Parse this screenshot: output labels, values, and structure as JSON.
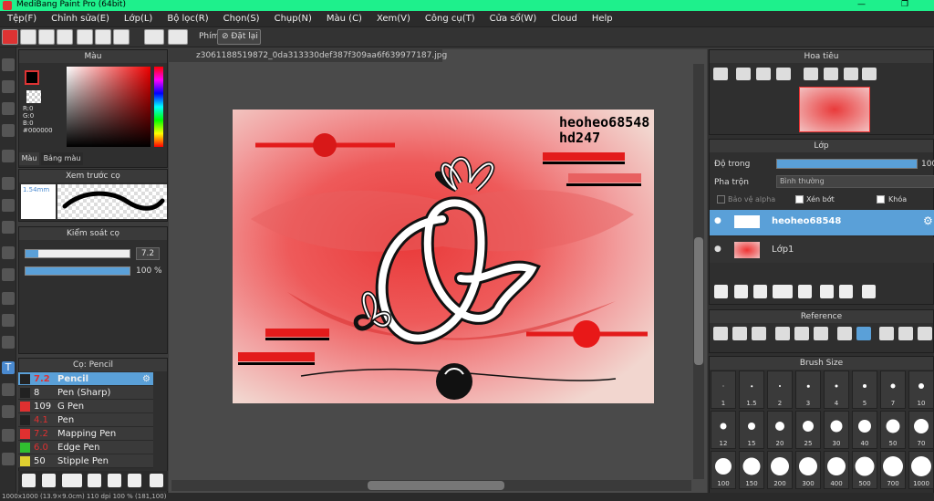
{
  "app": {
    "title": "MediBang Paint Pro (64bit)"
  },
  "menu": [
    "Tệp(F)",
    "Chỉnh sửa(E)",
    "Lớp(L)",
    "Bộ lọc(R)",
    "Chọn(S)",
    "Chụp(N)",
    "Màu (C)",
    "Xem(V)",
    "Công cụ(T)",
    "Cửa sổ(W)",
    "Cloud",
    "Help"
  ],
  "toolbar": {
    "phim": "Phím",
    "reset": "Đặt lại"
  },
  "color_panel": {
    "title": "Màu",
    "r": "R:0",
    "g": "G:0",
    "b": "B:0",
    "hex": "#000000",
    "tab1": "Màu",
    "tab2": "Bảng màu"
  },
  "brush_preview": {
    "title": "Xem trước cọ",
    "size": "1.54mm"
  },
  "brush_control": {
    "title": "Kiểm soát cọ",
    "size": "7.2",
    "opacity": "100 %"
  },
  "brush_list": {
    "title": "Cọ: Pencil",
    "items": [
      {
        "num": "7.2",
        "name": "Pencil",
        "color": "#222222"
      },
      {
        "num": "8",
        "name": "Pen (Sharp)",
        "color": "#222222"
      },
      {
        "num": "109",
        "name": "G Pen",
        "color": "#e03030"
      },
      {
        "num": "4.1",
        "name": "Pen",
        "color": "#222222"
      },
      {
        "num": "7.2",
        "name": "Mapping Pen",
        "color": "#e03030"
      },
      {
        "num": "6.0",
        "name": "Edge Pen",
        "color": "#30c030"
      },
      {
        "num": "50",
        "name": "Stipple Pen",
        "color": "#e0d030"
      }
    ]
  },
  "canvas": {
    "filename": "z3061188519872_0da313330def387f309aa6f639977187.jpg",
    "text1": "heoheo68548",
    "text2": "hd247"
  },
  "navigator": {
    "title": "Hoa tiêu"
  },
  "layer_panel": {
    "title": "Lớp",
    "opacity_label": "Độ trong",
    "opacity_value": "100",
    "blend_label": "Pha trộn",
    "blend_value": "Bình thường",
    "protect": "Bảo vệ alpha",
    "clip": "Xén bớt",
    "lock": "Khóa",
    "layers": [
      {
        "name": "heoheo68548"
      },
      {
        "name": "Lớp1"
      }
    ]
  },
  "reference": {
    "title": "Reference"
  },
  "brush_size": {
    "title": "Brush Size",
    "sizes": [
      "1",
      "1.5",
      "2",
      "3",
      "4",
      "5",
      "7",
      "10",
      "12",
      "15",
      "20",
      "25",
      "30",
      "40",
      "50",
      "70",
      "100",
      "150",
      "200",
      "300",
      "400",
      "500",
      "700",
      "1000"
    ]
  },
  "status": "1000x1000 (13.9×9.0cm) 110 dpi 100 % (181,100)",
  "colors": {
    "accent": "#1ef08c",
    "selected": "#5aa0d8",
    "red": "#e83a3a"
  }
}
